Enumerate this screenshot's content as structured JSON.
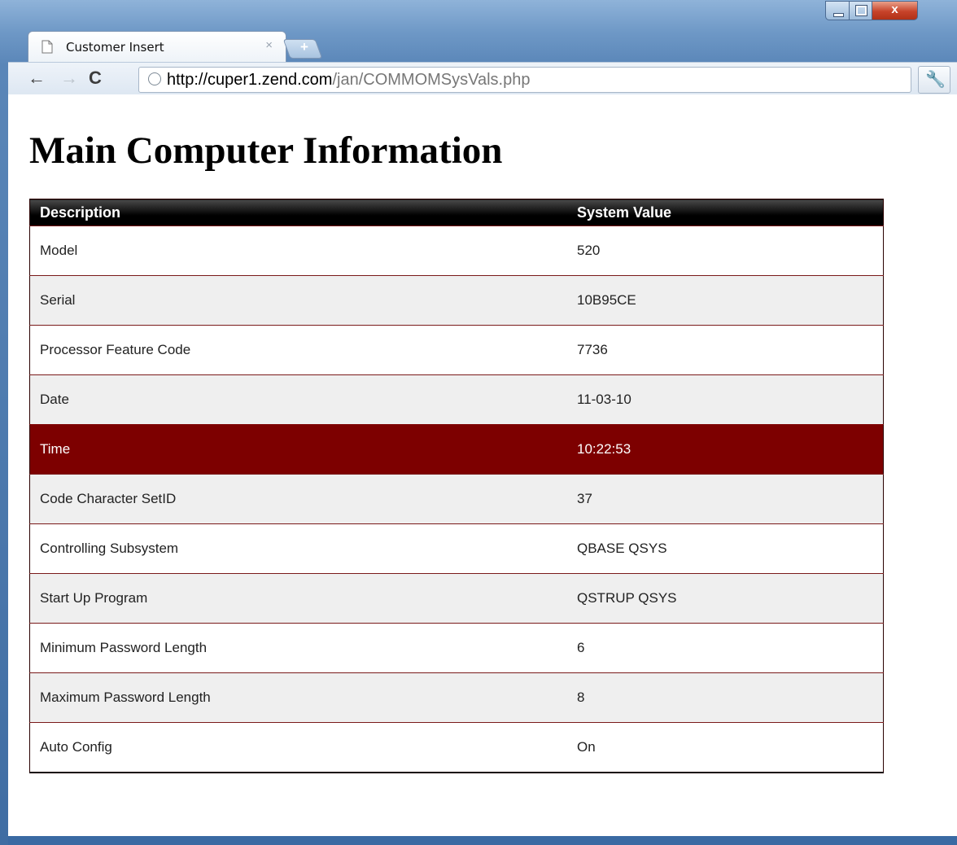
{
  "browser": {
    "tab_title": "Customer Insert",
    "tab_close": "×",
    "new_tab": "+",
    "close_glyph": "x",
    "url_host": "http://cuper1.zend.com",
    "url_path": "/jan/COMMOMSysVals.php",
    "back_glyph": "←",
    "forward_glyph": "→",
    "reload_glyph": "C",
    "wrench_glyph": "🔧"
  },
  "page": {
    "heading": "Main Computer Information",
    "table": {
      "headers": [
        "Description",
        "System Value"
      ],
      "rows": [
        {
          "description": "Model",
          "value": "520"
        },
        {
          "description": "Serial",
          "value": "10B95CE"
        },
        {
          "description": "Processor Feature Code",
          "value": "7736"
        },
        {
          "description": "Date",
          "value": "11-03-10"
        },
        {
          "description": "Time",
          "value": "10:22:53"
        },
        {
          "description": "Code Character SetID",
          "value": "37"
        },
        {
          "description": "Controlling Subsystem",
          "value": "QBASE QSYS"
        },
        {
          "description": "Start Up Program",
          "value": "QSTRUP QSYS"
        },
        {
          "description": "Minimum Password Length",
          "value": "6"
        },
        {
          "description": "Maximum Password Length",
          "value": "8"
        },
        {
          "description": "Auto Config",
          "value": "On"
        }
      ],
      "highlight_color": "#7d0000",
      "header_color": "#000000"
    }
  }
}
